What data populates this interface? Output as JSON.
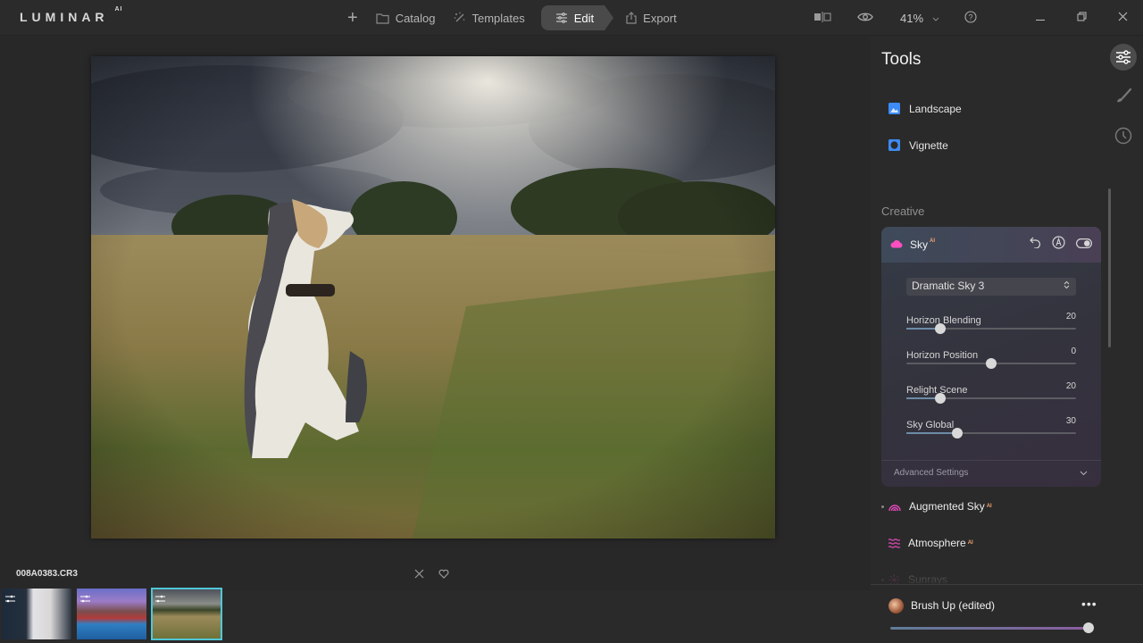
{
  "app": {
    "logo": "LUMINAR",
    "logo_sup": "AI"
  },
  "nav": {
    "add_label": "+",
    "items": [
      {
        "label": "Catalog",
        "icon": "folder-icon"
      },
      {
        "label": "Templates",
        "icon": "magic-wand-icon"
      },
      {
        "label": "Edit",
        "icon": "sliders-icon",
        "active": true
      },
      {
        "label": "Export",
        "icon": "share-icon"
      }
    ]
  },
  "toolbar": {
    "zoom": "41%",
    "compare_icon": "compare-icon",
    "preview_icon": "eye-icon",
    "help_icon": "help-icon"
  },
  "window": {
    "minimize": "minimize",
    "restore": "restore",
    "close": "close"
  },
  "image": {
    "filename": "008A0383.CR3"
  },
  "filmstrip": {
    "thumbs": [
      {
        "name": "wedding-couple",
        "edited": true,
        "selected": false
      },
      {
        "name": "lofoten-village",
        "edited": true,
        "selected": false
      },
      {
        "name": "dog-in-field",
        "edited": true,
        "selected": true
      }
    ]
  },
  "panel": {
    "title": "Tools",
    "tabs": [
      "tools",
      "local-masking",
      "history"
    ],
    "essentials": [
      {
        "label": "Landscape",
        "icon": "landscape-icon",
        "color": "#3d8bf5"
      },
      {
        "label": "Vignette",
        "icon": "vignette-icon",
        "color": "#3d8bf5"
      }
    ],
    "section": "Creative",
    "sky": {
      "title": "Sky",
      "ai_badge": "AI",
      "color": "#ff4fc0",
      "selected_sky": "Dramatic Sky 3",
      "sliders": [
        {
          "label": "Horizon Blending",
          "value": 20,
          "min": 0,
          "max": 100
        },
        {
          "label": "Horizon Position",
          "value": 0,
          "min": -100,
          "max": 100
        },
        {
          "label": "Relight Scene",
          "value": 20,
          "min": 0,
          "max": 100
        },
        {
          "label": "Sky Global",
          "value": 30,
          "min": 0,
          "max": 100
        }
      ],
      "advanced": "Advanced Settings"
    },
    "creative_tools": [
      {
        "label": "Augmented Sky",
        "ai": "AI",
        "dot": true
      },
      {
        "label": "Atmosphere",
        "ai": "AI",
        "dot": false
      },
      {
        "label": "Sunrays",
        "ai": "",
        "dot": true
      }
    ]
  },
  "preset": {
    "name": "Brush Up (edited)",
    "more": "•••",
    "amount": 100
  }
}
